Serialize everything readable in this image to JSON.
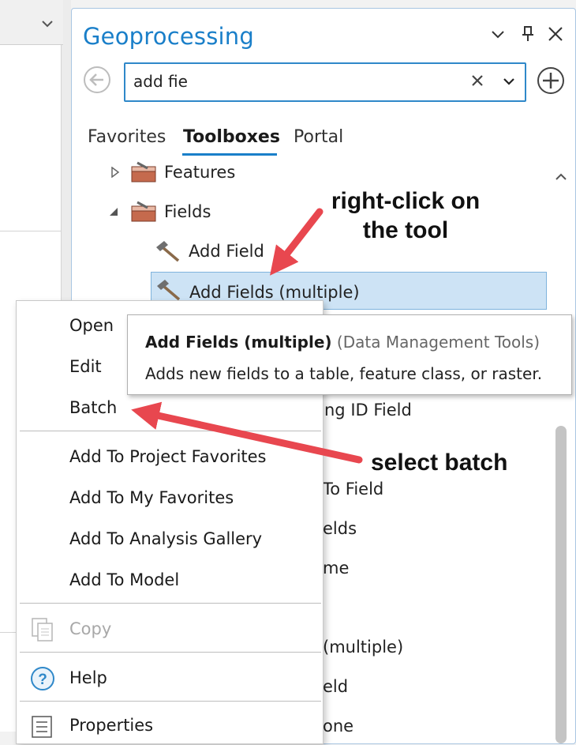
{
  "pane": {
    "title": "Geoprocessing",
    "search": {
      "value": "add fie"
    },
    "tabs": [
      {
        "label": "Favorites",
        "active": false
      },
      {
        "label": "Toolboxes",
        "active": true
      },
      {
        "label": "Portal",
        "active": false
      }
    ],
    "tree": [
      {
        "label": "Features",
        "kind": "toolbox",
        "expanded": false
      },
      {
        "label": "Fields",
        "kind": "toolbox",
        "expanded": true
      },
      {
        "label": "Add Field",
        "kind": "tool"
      },
      {
        "label": "Add Fields (multiple)",
        "kind": "tool",
        "selected": true
      }
    ],
    "hidden_fragments": [
      "ng ID Field",
      "To Field",
      "elds",
      "me",
      "(multiple)",
      "eld",
      "one"
    ]
  },
  "tooltip": {
    "title": "Add Fields (multiple)",
    "source": "(Data Management Tools)",
    "description": "Adds new fields to a table, feature class, or raster."
  },
  "context_menu": {
    "items": [
      {
        "label": "Open",
        "enabled": true
      },
      {
        "label": "Edit",
        "enabled": true
      },
      {
        "label": "Batch",
        "enabled": true
      },
      {
        "label": "Add To Project Favorites",
        "enabled": true
      },
      {
        "label": "Add To My Favorites",
        "enabled": true
      },
      {
        "label": "Add To Analysis Gallery",
        "enabled": true
      },
      {
        "label": "Add To Model",
        "enabled": true
      },
      {
        "label": "Copy",
        "enabled": false,
        "icon": "copy-icon"
      },
      {
        "label": "Help",
        "enabled": true,
        "icon": "help-icon"
      },
      {
        "label": "Properties",
        "enabled": true,
        "icon": "properties-icon"
      }
    ]
  },
  "annotations": {
    "right_click": "right-click on\nthe tool",
    "select_batch": "select batch",
    "arrow_color": "#e8474f"
  },
  "colors": {
    "accent": "#1a7fc9",
    "selection": "#cde3f5"
  }
}
